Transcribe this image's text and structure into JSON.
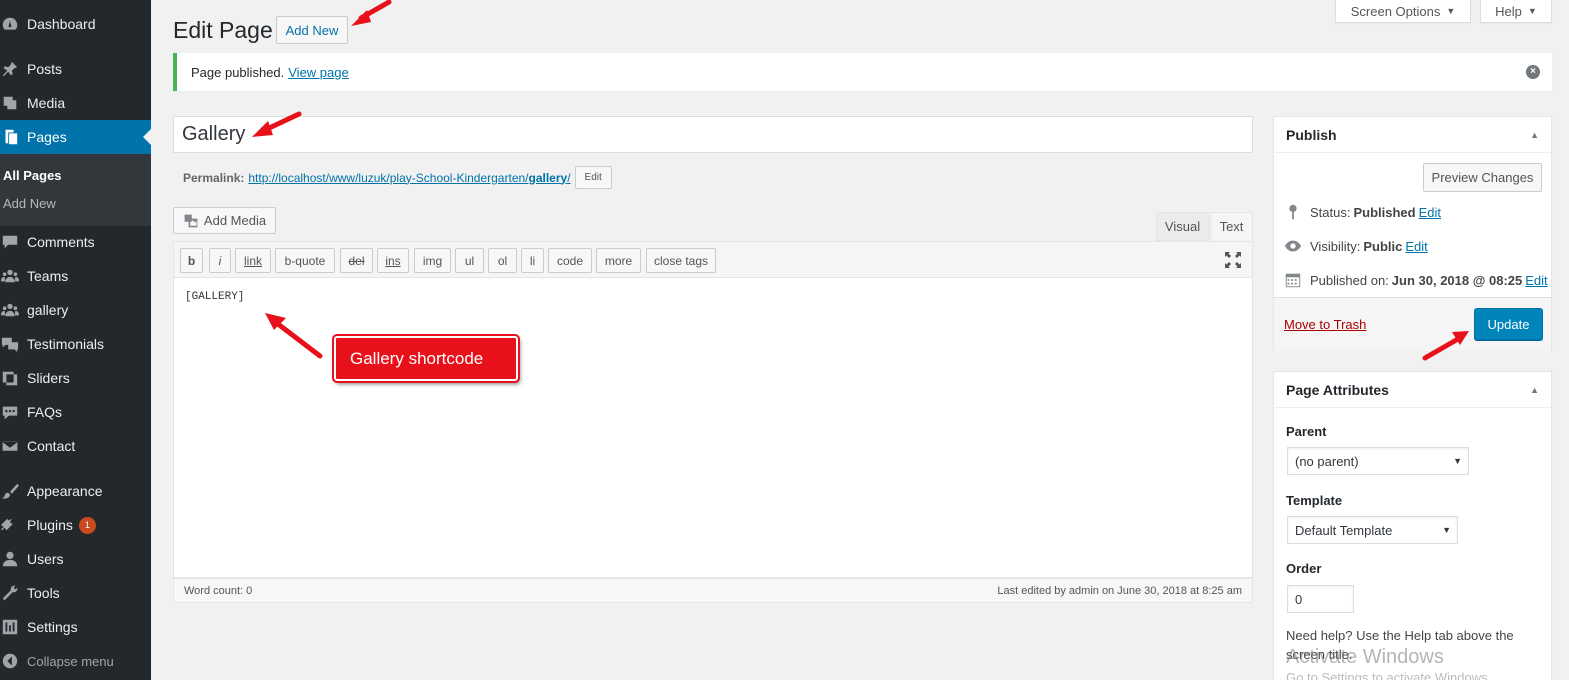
{
  "sidebar": {
    "items": [
      {
        "label": "Dashboard",
        "icon": "dashboard-icon"
      },
      {
        "label": "Posts",
        "icon": "pin-icon"
      },
      {
        "label": "Media",
        "icon": "media-icon"
      },
      {
        "label": "Pages",
        "icon": "pages-icon"
      },
      {
        "label": "Comments",
        "icon": "comments-icon"
      },
      {
        "label": "Teams",
        "icon": "groups-icon"
      },
      {
        "label": "gallery",
        "icon": "groups-icon"
      },
      {
        "label": "Testimonials",
        "icon": "testimonial-icon"
      },
      {
        "label": "Sliders",
        "icon": "slides-icon"
      },
      {
        "label": "FAQs",
        "icon": "faq-icon"
      },
      {
        "label": "Contact",
        "icon": "email-icon"
      },
      {
        "label": "Appearance",
        "icon": "brush-icon"
      },
      {
        "label": "Plugins",
        "icon": "plugin-icon",
        "badge": "1"
      },
      {
        "label": "Users",
        "icon": "users-icon"
      },
      {
        "label": "Tools",
        "icon": "wrench-icon"
      },
      {
        "label": "Settings",
        "icon": "settings-icon"
      }
    ],
    "submenu": [
      "All Pages",
      "Add New"
    ],
    "collapse_label": "Collapse menu"
  },
  "header": {
    "title": "Edit Page",
    "add_new_label": "Add New",
    "screen_options_label": "Screen Options",
    "help_label": "Help"
  },
  "notice": {
    "text": "Page published.",
    "link": "View page"
  },
  "editor": {
    "title_value": "Gallery",
    "permalink_label": "Permalink:",
    "permalink_base": "http://localhost/www/luzuk/play-School-Kindergarten/",
    "permalink_slug": "gallery",
    "permalink_end": "/",
    "permalink_edit": "Edit",
    "add_media_label": "Add Media",
    "tab_visual": "Visual",
    "tab_text": "Text",
    "quicktags": [
      "b",
      "i",
      "link",
      "b-quote",
      "del",
      "ins",
      "img",
      "ul",
      "ol",
      "li",
      "code",
      "more",
      "close tags"
    ],
    "content": "[GALLERY]",
    "word_count": "Word count: 0",
    "last_edited": "Last edited by admin on June 30, 2018 at 8:25 am"
  },
  "publish": {
    "title": "Publish",
    "preview_label": "Preview Changes",
    "status_label": "Status:",
    "status_value": "Published",
    "visibility_label": "Visibility:",
    "visibility_value": "Public",
    "published_label": "Published on:",
    "published_value": "Jun 30, 2018 @ 08:25",
    "edit_label": "Edit",
    "trash_label": "Move to Trash",
    "update_label": "Update"
  },
  "page_attributes": {
    "title": "Page Attributes",
    "parent_label": "Parent",
    "parent_value": "(no parent)",
    "template_label": "Template",
    "template_value": "Default Template",
    "order_label": "Order",
    "order_value": "0",
    "help_text": "Need help? Use the Help tab above the screen title."
  },
  "annotation": {
    "callout_text": "Gallery shortcode"
  },
  "watermark": {
    "title": "Activate Windows",
    "subtitle": "Go to Settings to activate Windows."
  },
  "colors": {
    "sidebar_bg": "#23282d",
    "accent": "#0073aa",
    "primary_button": "#0085ba",
    "notice_success": "#46b450",
    "annotation_red": "#e8101a"
  }
}
